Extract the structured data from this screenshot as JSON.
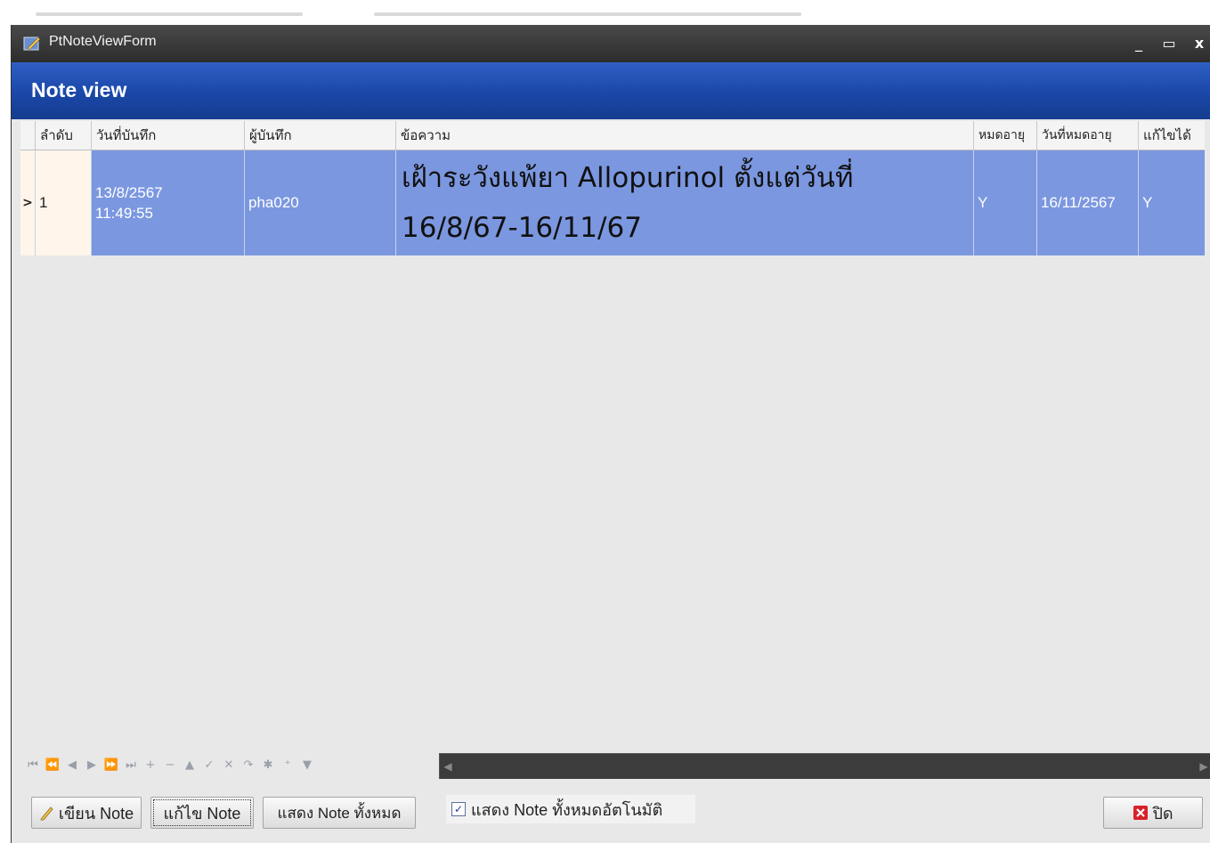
{
  "window": {
    "title": "PtNoteViewForm",
    "minimize_glyph": "_",
    "maximize_glyph": "▭",
    "close_glyph": "x"
  },
  "header": {
    "title": "Note view"
  },
  "grid": {
    "columns": [
      "ลำดับ",
      "วันที่บันทึก",
      "ผู้บันทึก",
      "ข้อความ",
      "หมดอายุ",
      "วันที่หมดอายุ",
      "แก้ไขได้"
    ],
    "rows": [
      {
        "indicator": ">",
        "seq": "1",
        "date": "13/8/2567",
        "time": "11:49:55",
        "recorder": "pha020",
        "message_line1": "เฝ้าระวังแพ้ยา Allopurinol ตั้งแต่วันที่",
        "message_line2": "16/8/67-16/11/67",
        "expired": "Y",
        "expire_date": "16/11/2567",
        "editable": "Y"
      }
    ]
  },
  "navigator": {
    "buttons": [
      "⏮",
      "⏪",
      "◀",
      "▶",
      "⏩",
      "⏭",
      "+",
      "−",
      "▲",
      "✓",
      "✕",
      "↷",
      "✱",
      "⁺",
      "▼"
    ]
  },
  "bottom": {
    "write_note": "เขียน Note",
    "edit_note": "แก้ไข Note",
    "show_all": "แสดง Note ทั้งหมด",
    "auto_show_label": "แสดง Note ทั้งหมดอัตโนมัติ",
    "auto_show_checked": true,
    "close": "ปิด"
  },
  "colors": {
    "header_blue": "#1a47a8",
    "selected_row": "#7b97e0",
    "close_icon_red": "#d8222a"
  }
}
